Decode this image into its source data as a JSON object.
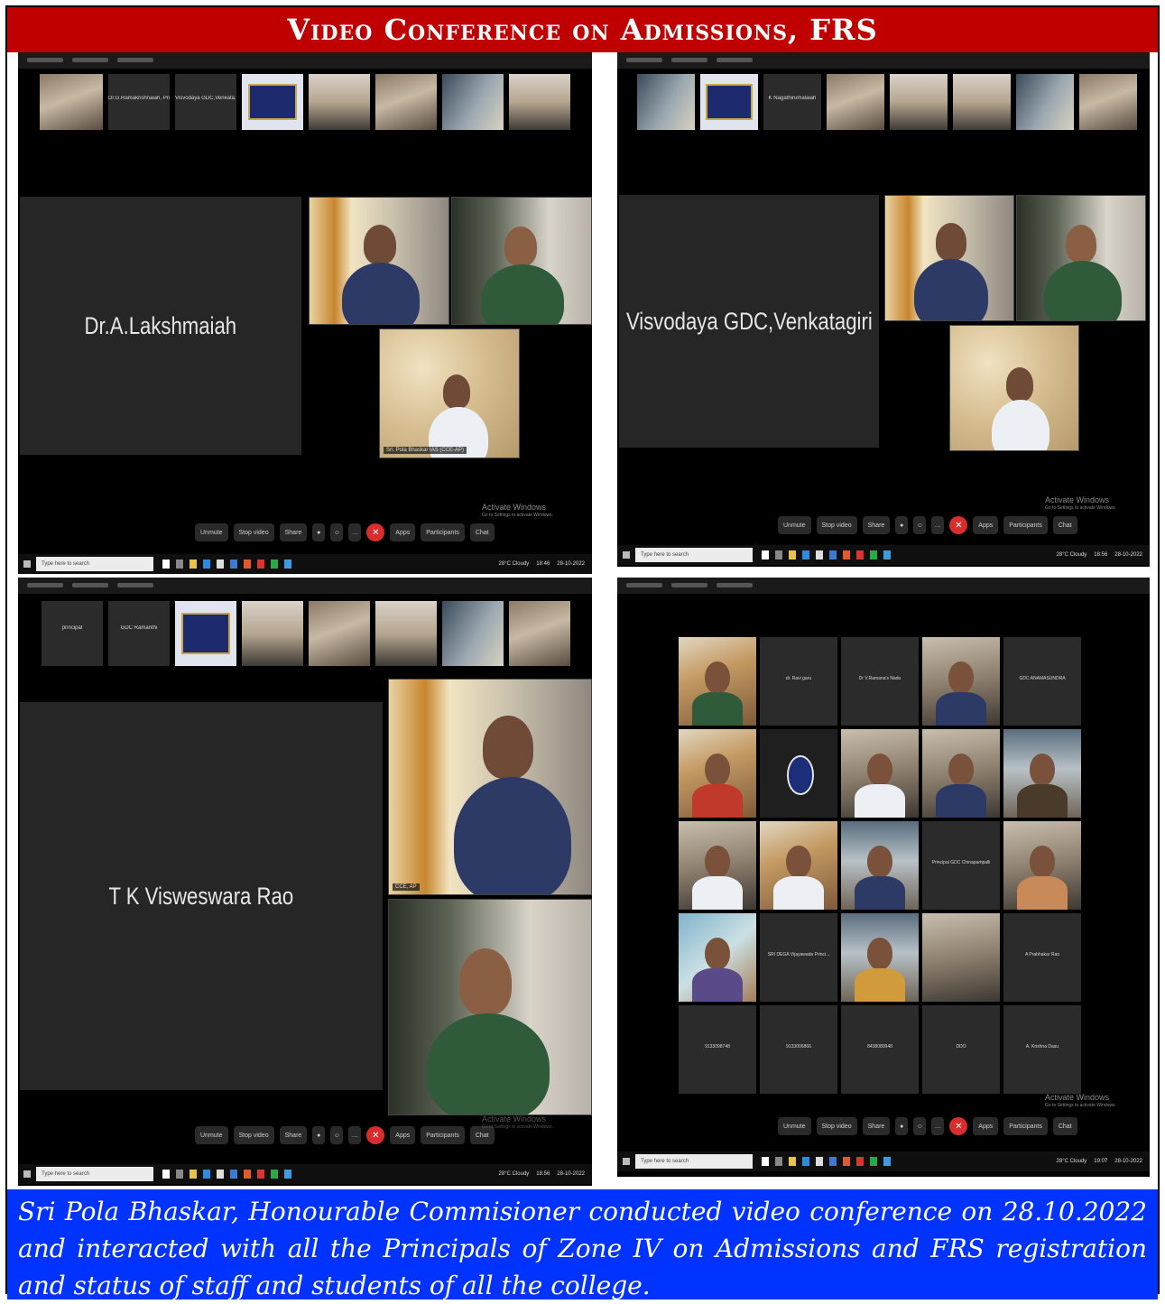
{
  "banner": {
    "title": "Video Conference on Admissions, FRS"
  },
  "shots": [
    {
      "main_tile_name": "Dr.A.Lakshmaiah",
      "thumb_labels": [
        "",
        "Dr.G.Ramakrishnaiah, Princ...",
        "Visvodaya GDC,Venkata...",
        "",
        "",
        "",
        "",
        ""
      ],
      "video_tag": "Sri. Pola Bhaskar IAS (CCE-AP)",
      "controls": [
        "Unmute",
        "Stop video",
        "Share",
        "Apps",
        "Participants",
        "Chat"
      ],
      "watermark": {
        "title": "Activate Windows",
        "sub": "Go to Settings to activate Windows."
      },
      "taskbar_search": "Type here to search",
      "tray": [
        "28°C Cloudy",
        "18:46",
        "28-10-2022"
      ]
    },
    {
      "main_tile_name": "Visvodaya GDC,Venkatagiri",
      "thumb_labels": [
        "",
        "",
        "K Nagathirumalaiah",
        "",
        "",
        "",
        "",
        ""
      ],
      "controls": [
        "Unmute",
        "Stop video",
        "Share",
        "Apps",
        "Participants",
        "Chat"
      ],
      "watermark": {
        "title": "Activate Windows",
        "sub": "Go to Settings to activate Windows."
      },
      "taskbar_search": "Type here to search",
      "tray": [
        "28°C Cloudy",
        "18:56",
        "28-10-2022"
      ]
    },
    {
      "main_tile_name": "T K Visweswara Rao",
      "thumb_labels": [
        "principal",
        "GDC Ramanthi",
        "",
        "",
        "",
        "",
        "",
        ""
      ],
      "video_tag": "CCE, AP",
      "controls": [
        "Unmute",
        "Stop video",
        "Share",
        "Apps",
        "Participants",
        "Chat"
      ],
      "watermark": {
        "title": "Activate Windows",
        "sub": "Go to Settings to activate Windows."
      },
      "taskbar_search": "Type here to search",
      "tray": [
        "28°C Cloudy",
        "18:56",
        "28-10-2022"
      ]
    },
    {
      "gallery_labels": [
        "",
        "dr. Ravi garu",
        "Dr V.Ramana's Nadu",
        "",
        "GDC ANAMASUNDRA",
        "",
        "",
        "",
        "",
        "",
        "",
        "",
        "",
        "Principal GDC Chinapampalli",
        "",
        "",
        "SRI DEGA Vijayawada Princi...",
        "",
        "",
        "A Prabhakar Rao",
        "9133098748",
        "9133006866",
        "8438080948",
        "DDO",
        "A. Krishna Dasu"
      ],
      "controls": [
        "Unmute",
        "Stop video",
        "Share",
        "Apps",
        "Participants",
        "Chat"
      ],
      "watermark": {
        "title": "Activate Windows",
        "sub": "Go to Settings to activate Windows."
      },
      "taskbar_search": "Type here to search",
      "tray": [
        "28°C Cloudy",
        "19:07",
        "28-10-2022"
      ]
    }
  ],
  "caption": {
    "text": "Sri Pola Bhaskar, Honourable Commisioner conducted video conference on 28.10.2022 and interacted with all the Principals of Zone IV on Admissions and FRS registration and status of staff and students of all the college."
  },
  "colors": {
    "banner_bg": "#c00000",
    "caption_bg": "#0033ff",
    "meeting_bg": "#000000",
    "tile_bg": "#262626",
    "leave_red": "#d92c2c"
  }
}
